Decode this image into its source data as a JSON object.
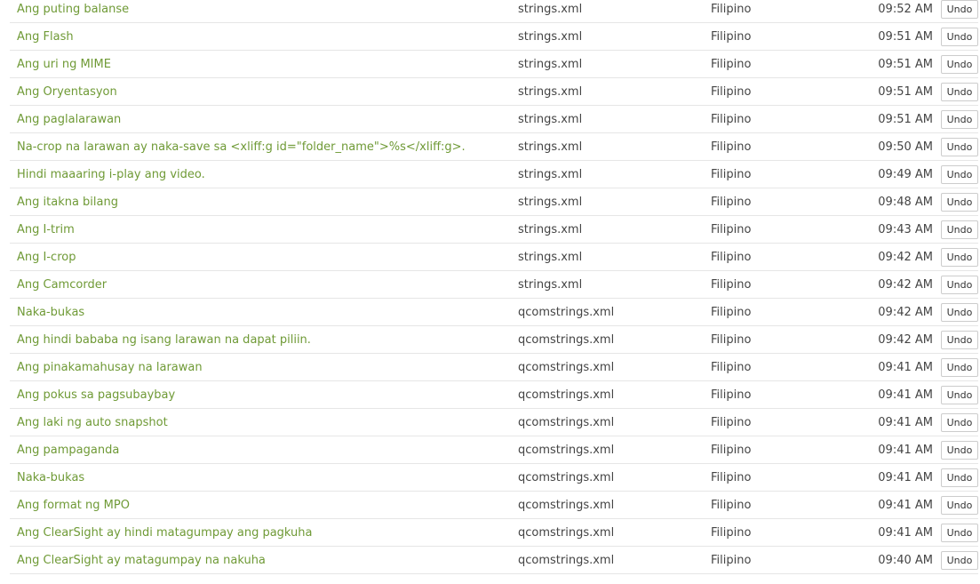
{
  "history": {
    "action_label": "Undo",
    "rows": [
      {
        "text": "Ang puting balanse",
        "file": "strings.xml",
        "language": "Filipino",
        "time": "09:52 AM"
      },
      {
        "text": "Ang Flash",
        "file": "strings.xml",
        "language": "Filipino",
        "time": "09:51 AM"
      },
      {
        "text": "Ang uri ng MIME",
        "file": "strings.xml",
        "language": "Filipino",
        "time": "09:51 AM"
      },
      {
        "text": "Ang Oryentasyon",
        "file": "strings.xml",
        "language": "Filipino",
        "time": "09:51 AM"
      },
      {
        "text": "Ang paglalarawan",
        "file": "strings.xml",
        "language": "Filipino",
        "time": "09:51 AM"
      },
      {
        "text": "Na-crop na larawan ay naka-save sa <xliff:g id=\"folder_name\">%s</xliff:g>.",
        "file": "strings.xml",
        "language": "Filipino",
        "time": "09:50 AM"
      },
      {
        "text": "Hindi maaaring i-play ang video.",
        "file": "strings.xml",
        "language": "Filipino",
        "time": "09:49 AM"
      },
      {
        "text": "Ang itakna bilang",
        "file": "strings.xml",
        "language": "Filipino",
        "time": "09:48 AM"
      },
      {
        "text": "Ang I-trim",
        "file": "strings.xml",
        "language": "Filipino",
        "time": "09:43 AM"
      },
      {
        "text": "Ang I-crop",
        "file": "strings.xml",
        "language": "Filipino",
        "time": "09:42 AM"
      },
      {
        "text": "Ang Camcorder",
        "file": "strings.xml",
        "language": "Filipino",
        "time": "09:42 AM"
      },
      {
        "text": "Naka-bukas",
        "file": "qcomstrings.xml",
        "language": "Filipino",
        "time": "09:42 AM"
      },
      {
        "text": "Ang hindi bababa ng isang larawan na dapat piliin.",
        "file": "qcomstrings.xml",
        "language": "Filipino",
        "time": "09:42 AM"
      },
      {
        "text": "Ang pinakamahusay na larawan",
        "file": "qcomstrings.xml",
        "language": "Filipino",
        "time": "09:41 AM"
      },
      {
        "text": "Ang pokus sa pagsubaybay",
        "file": "qcomstrings.xml",
        "language": "Filipino",
        "time": "09:41 AM"
      },
      {
        "text": "Ang laki ng auto snapshot",
        "file": "qcomstrings.xml",
        "language": "Filipino",
        "time": "09:41 AM"
      },
      {
        "text": "Ang pampaganda",
        "file": "qcomstrings.xml",
        "language": "Filipino",
        "time": "09:41 AM"
      },
      {
        "text": "Naka-bukas",
        "file": "qcomstrings.xml",
        "language": "Filipino",
        "time": "09:41 AM"
      },
      {
        "text": "Ang format ng MPO",
        "file": "qcomstrings.xml",
        "language": "Filipino",
        "time": "09:41 AM"
      },
      {
        "text": "Ang ClearSight ay hindi matagumpay ang pagkuha",
        "file": "qcomstrings.xml",
        "language": "Filipino",
        "time": "09:41 AM"
      },
      {
        "text": "Ang ClearSight ay matagumpay na nakuha",
        "file": "qcomstrings.xml",
        "language": "Filipino",
        "time": "09:40 AM"
      }
    ]
  }
}
